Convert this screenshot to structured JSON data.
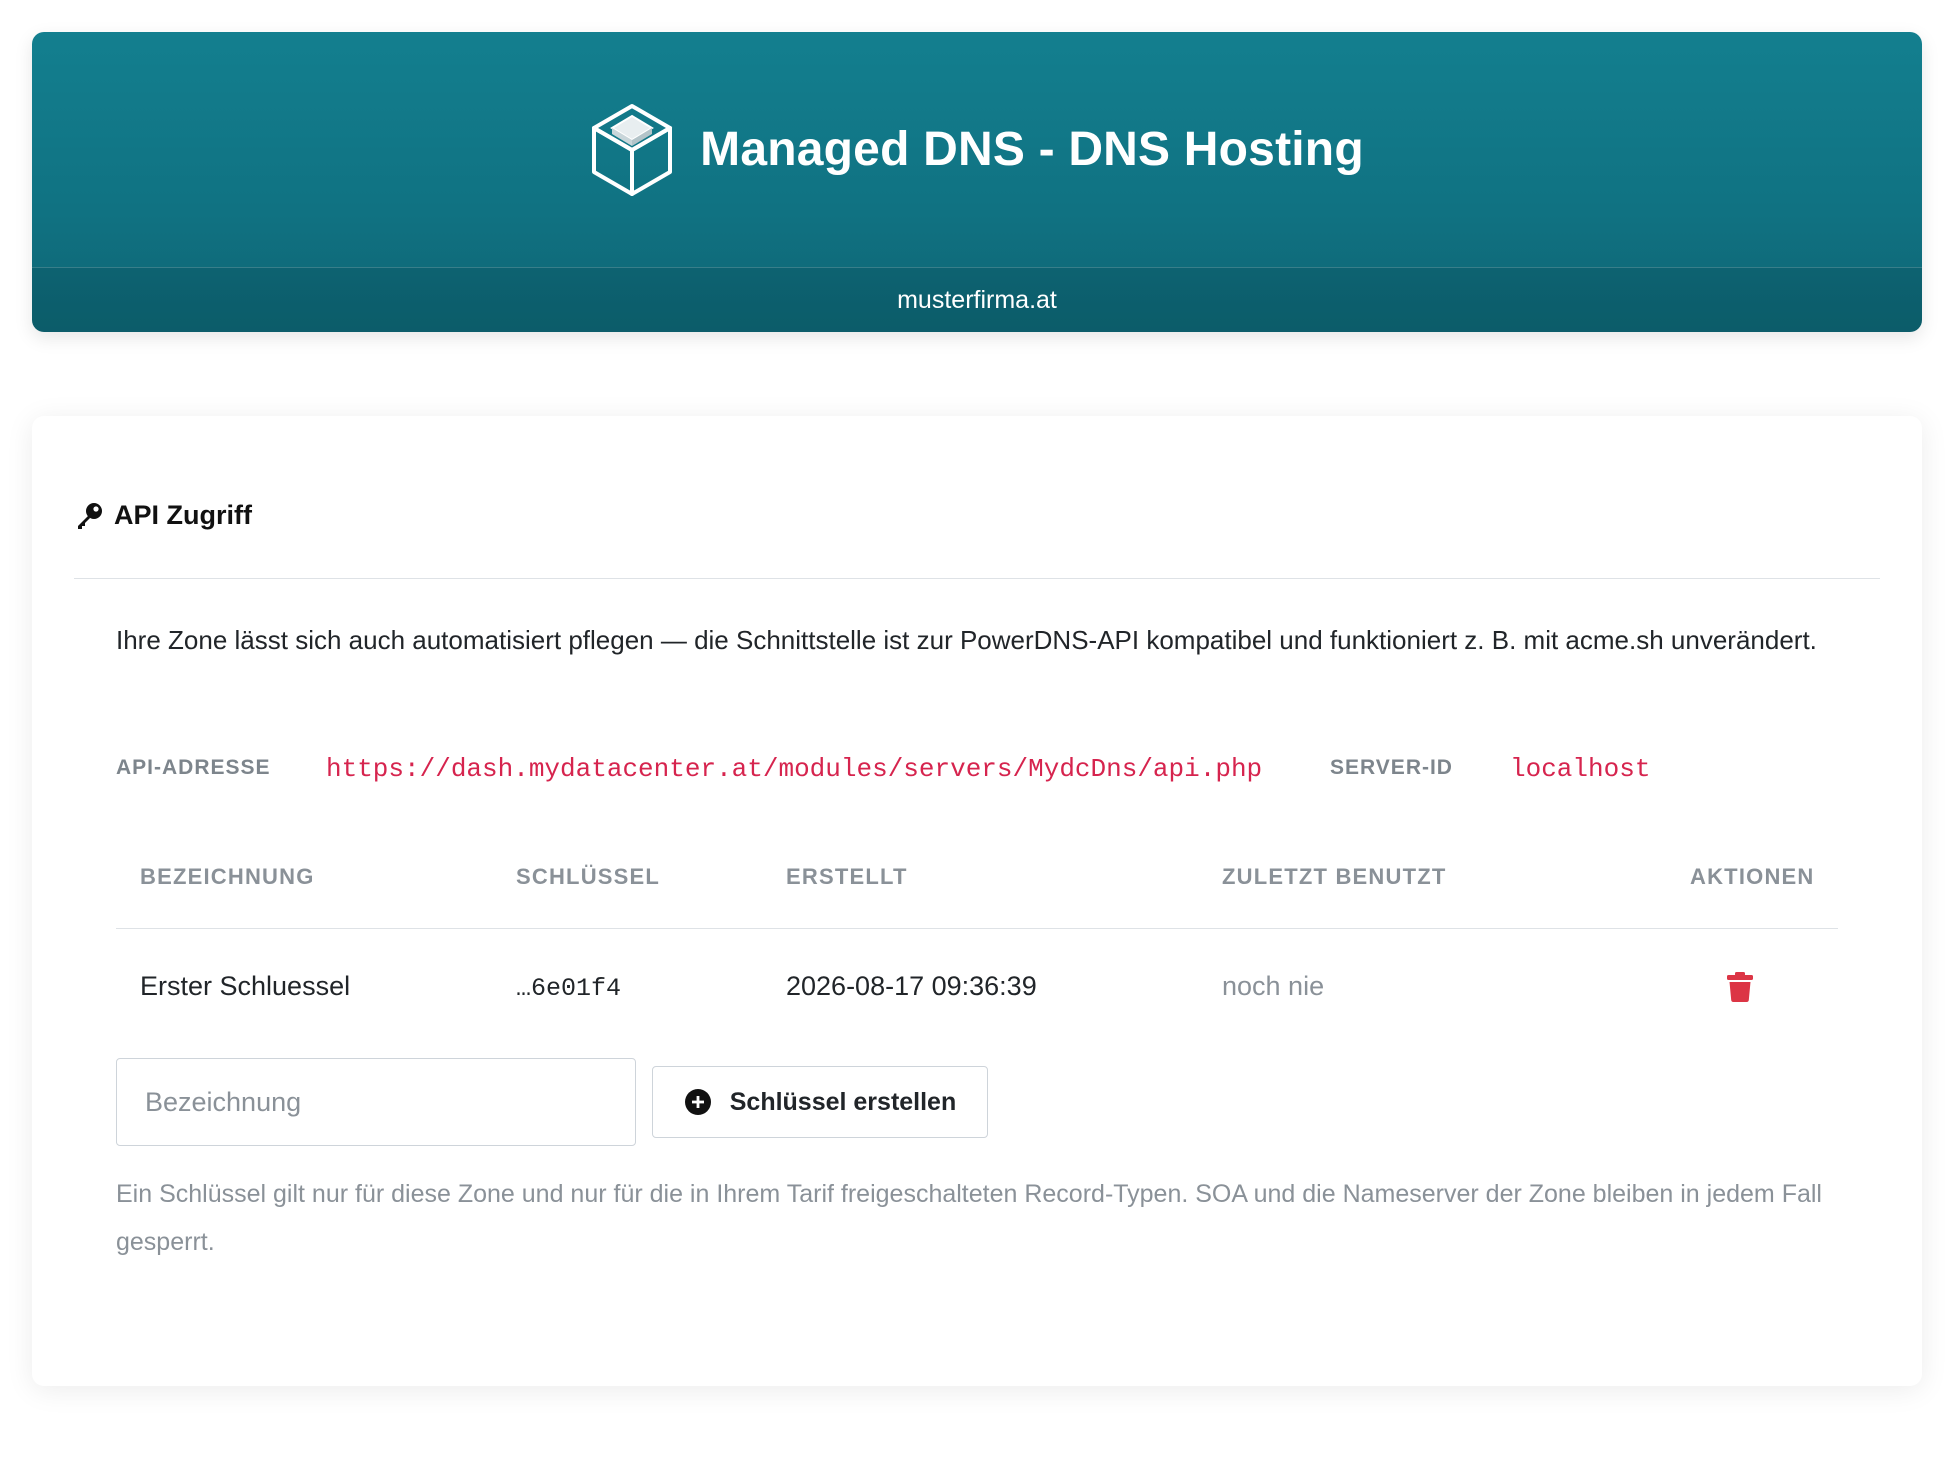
{
  "header": {
    "title": "Managed DNS - DNS Hosting",
    "domain": "musterfirma.at",
    "logo_icon": "cube-icon",
    "colors": {
      "banner": "#127a8a",
      "banner_text": "#ffffff"
    }
  },
  "api_card": {
    "title": "API Zugriff",
    "title_icon": "key-icon",
    "intro": "Ihre Zone lässt sich auch automatisiert pflegen — die Schnittstelle ist zur PowerDNS-API kompatibel und funktioniert z. B. mit acme.sh unverändert.",
    "api_address_label": "API-ADRESSE",
    "api_address": "https://dash.mydatacenter.at/modules/servers/MydcDns/api.php",
    "server_id_label": "SERVER-ID",
    "server_id": "localhost",
    "code_color": "#d6244e",
    "table": {
      "columns": [
        "BEZEICHNUNG",
        "SCHLÜSSEL",
        "ERSTELLT",
        "ZULETZT BENUTZT",
        "AKTIONEN"
      ],
      "rows": [
        {
          "name": "Erster Schluessel",
          "key": "…6e01f4",
          "created": "2026-08-17 09:36:39",
          "last_used": "noch nie",
          "action_icon": "trash-icon"
        }
      ]
    },
    "name_input": {
      "placeholder": "Bezeichnung",
      "value": ""
    },
    "create_button": {
      "label": "Schlüssel erstellen",
      "icon": "plus-circle-icon"
    },
    "note": "Ein Schlüssel gilt nur für diese Zone und nur für die in Ihrem Tarif freigeschalteten Record-Typen. SOA und die Nameserver der Zone bleiben in jedem Fall gesperrt.",
    "danger_color": "#dc3545"
  }
}
